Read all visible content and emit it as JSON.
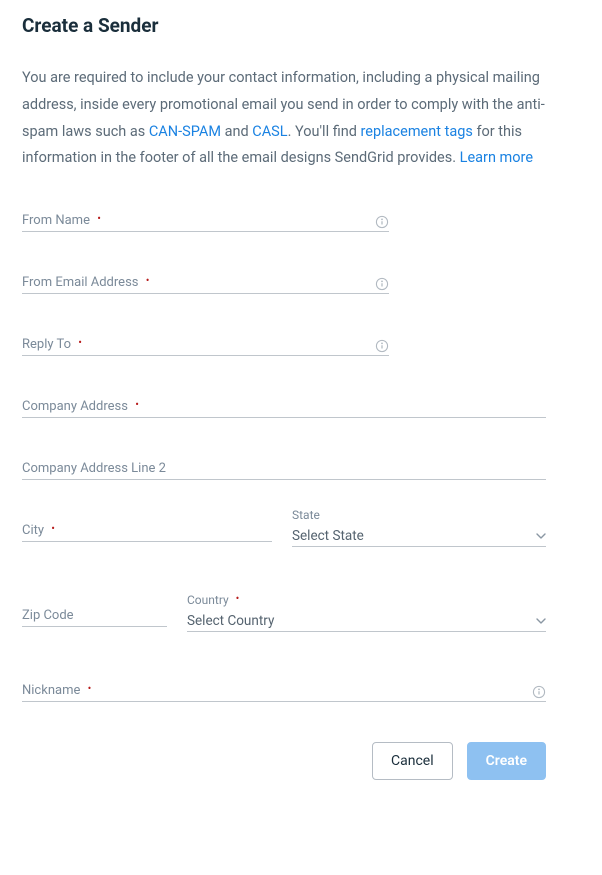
{
  "title": "Create a Sender",
  "intro": {
    "part1": "You are required to include your contact information, including a physical mailing address, inside every promotional email you send in order to comply with the anti-spam laws such as ",
    "link_canspam": "CAN-SPAM",
    "part2": " and ",
    "link_casl": "CASL",
    "part3": ". You'll find ",
    "link_replacement": "replacement tags",
    "part4": " for this information in the footer of all the email designs SendGrid provides. ",
    "link_learn": "Learn more"
  },
  "fields": {
    "from_name": {
      "label": "From Name",
      "required": true,
      "info": true
    },
    "from_email": {
      "label": "From Email Address",
      "required": true,
      "info": true
    },
    "reply_to": {
      "label": "Reply To",
      "required": true,
      "info": true
    },
    "company_address": {
      "label": "Company Address",
      "required": true
    },
    "company_address_2": {
      "label": "Company Address Line 2",
      "required": false
    },
    "city": {
      "label": "City",
      "required": true
    },
    "state": {
      "label": "State",
      "placeholder": "Select State"
    },
    "zip": {
      "label": "Zip Code",
      "required": false
    },
    "country": {
      "label": "Country",
      "required": true,
      "placeholder": "Select Country"
    },
    "nickname": {
      "label": "Nickname",
      "required": true,
      "info": true
    }
  },
  "buttons": {
    "cancel": "Cancel",
    "create": "Create"
  },
  "required_marker": "•"
}
